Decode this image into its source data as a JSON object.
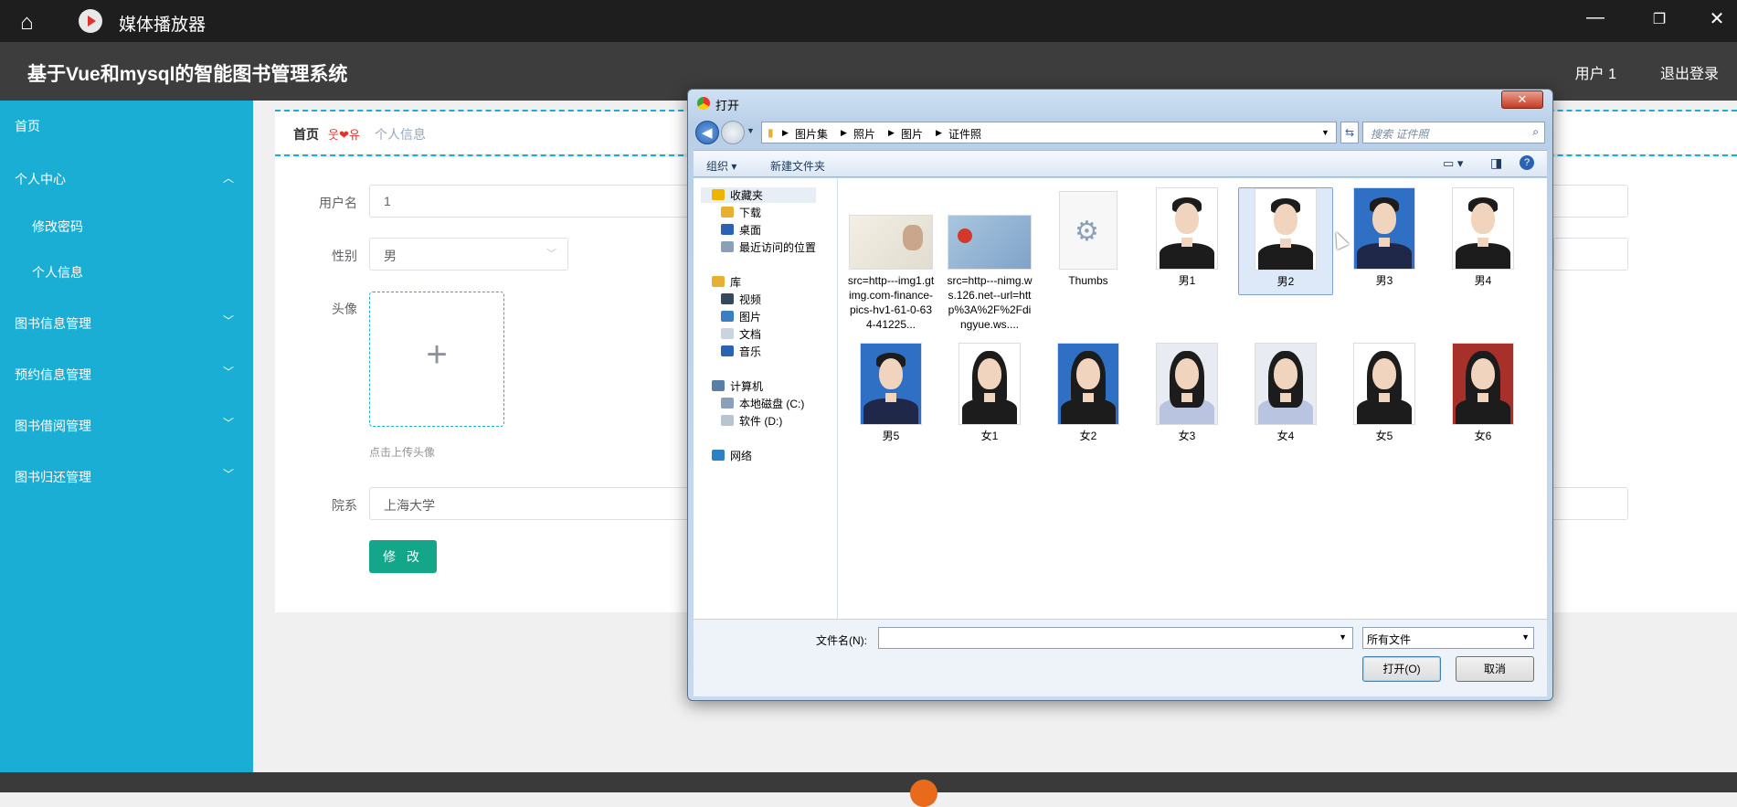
{
  "player": {
    "title": "媒体播放器",
    "home_icon": "⌂",
    "minimize_icon": "—",
    "restore_icon": "❐",
    "close_icon": "✕"
  },
  "header": {
    "title": "基于Vue和mysql的智能图书管理系统",
    "user": "用户 1",
    "logout": "退出登录"
  },
  "sidebar": {
    "home": "首页",
    "personal_center": "个人中心",
    "change_password": "修改密码",
    "personal_info": "个人信息",
    "book_info": "图书信息管理",
    "reservation": "预约信息管理",
    "borrow": "图书借阅管理",
    "return": "图书归还管理"
  },
  "breadcrumb": {
    "home": "首页",
    "separator": "웃❤유",
    "current": "个人信息"
  },
  "form": {
    "username_label": "用户名",
    "username_value": "1",
    "gender_label": "性别",
    "gender_value": "男",
    "avatar_label": "头像",
    "upload_hint": "点击上传头像",
    "dept_label": "院系",
    "dept_value": "上海大学",
    "submit": "修 改"
  },
  "dialog": {
    "title": "打开",
    "close": "✕",
    "path": [
      "图片集",
      "照片",
      "图片",
      "证件照"
    ],
    "search_placeholder": "搜索 证件照",
    "toolbar": {
      "organize": "组织 ▾",
      "new_folder": "新建文件夹"
    },
    "tree": [
      {
        "label": "收藏夹",
        "indent": 0,
        "icon": "favorites-star-icon"
      },
      {
        "label": "下载",
        "indent": 1,
        "icon": "download-folder-icon"
      },
      {
        "label": "桌面",
        "indent": 1,
        "icon": "desktop-icon"
      },
      {
        "label": "最近访问的位置",
        "indent": 1,
        "icon": "recent-places-icon"
      },
      {
        "label": "库",
        "indent": 0,
        "icon": "library-icon"
      },
      {
        "label": "视频",
        "indent": 1,
        "icon": "video-icon"
      },
      {
        "label": "图片",
        "indent": 1,
        "icon": "pictures-icon"
      },
      {
        "label": "文档",
        "indent": 1,
        "icon": "documents-icon"
      },
      {
        "label": "音乐",
        "indent": 1,
        "icon": "music-icon"
      },
      {
        "label": "计算机",
        "indent": 0,
        "icon": "computer-icon"
      },
      {
        "label": "本地磁盘 (C:)",
        "indent": 1,
        "icon": "local-disk-icon"
      },
      {
        "label": "软件 (D:)",
        "indent": 1,
        "icon": "drive-icon"
      },
      {
        "label": "网络",
        "indent": 0,
        "icon": "network-icon"
      }
    ],
    "files": [
      {
        "name": "src=http---img1.gtimg.com-finance-pics-hv1-61-0-634-41225...",
        "kind": "id-card"
      },
      {
        "name": "src=http---nimg.ws.126.net--url=http%3A%2F%2Fdingyue.ws....",
        "kind": "id-card-blue"
      },
      {
        "name": "Thumbs",
        "kind": "settings-file"
      },
      {
        "name": "男1",
        "kind": "male"
      },
      {
        "name": "男2",
        "kind": "male",
        "selected": true
      },
      {
        "name": "男3",
        "kind": "male-blue"
      },
      {
        "name": "男4",
        "kind": "male"
      },
      {
        "name": "男5",
        "kind": "male-blue"
      },
      {
        "name": "女1",
        "kind": "female"
      },
      {
        "name": "女2",
        "kind": "female-blue"
      },
      {
        "name": "女3",
        "kind": "female-light"
      },
      {
        "name": "女4",
        "kind": "female-light"
      },
      {
        "name": "女5",
        "kind": "female"
      },
      {
        "name": "女6",
        "kind": "female-red"
      }
    ],
    "filename_label": "文件名(N):",
    "filename_value": "",
    "filetype": "所有文件",
    "open": "打开(O)",
    "cancel": "取消"
  },
  "colors": {
    "sidebar": "#1aaed5",
    "header": "#3d3d3d",
    "accent_button": "#13a688"
  }
}
